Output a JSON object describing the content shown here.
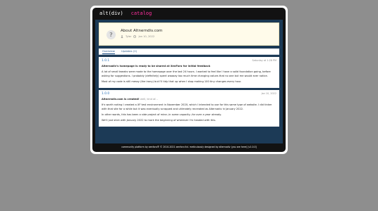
{
  "topbar": {
    "logo": "alt(div)",
    "nav_catalog": "catalog"
  },
  "header": {
    "avatar_glyph": "?",
    "title": "About Altnerndiv.com",
    "author": "Tyler",
    "date": "Jan 10, 2022",
    "author_icon": "user-icon",
    "date_icon": "clock-icon"
  },
  "tabs": [
    {
      "label": "Overview"
    },
    {
      "label": "Updates (2)"
    }
  ],
  "posts": [
    {
      "version": "1.0.1",
      "date": "Saturday at 1:28 PM",
      "headline": "Alternadiv's homepage is ready to be shared at XenForo for initial feedback",
      "headline_small": "",
      "paragraphs": [
        "A lot of small tweaks were made to the homepage over the last 24 hours. I wanted to feel like I have a solid foundation going, before asking for suggestions. I probably (definitely) spent waaaay too much time changing values that no one but me would ever notice.",
        "Most of my code is still messy (the irony) but I'll tidy that up when I stop making 100 tiny changes every hour."
      ]
    },
    {
      "version": "1.0.0",
      "date": "Jan 10, 2022",
      "headline": "Altnerndiv.com is created!",
      "headline_small": "well, kind of...",
      "paragraphs": [
        "It's worth noting I created a XF test environment in November 2020, which I intended to use for this same type of website. I did tinker with that site for a while but it was eventually scrapped and ultimately recreated as Alternadiv in January 2022.",
        "In other words, this has been a side project of mine--in some capacity--for over a year already.",
        "We'll just stick with January 2022 to mark the beginning of wherever I'm headed with this."
      ]
    }
  ],
  "footer": {
    "text": "community platform by xenforo® © 2010-2021 xenforo ltd. meticulously designed by alternadiv (you are here) [v1.0.0]"
  },
  "colors": {
    "page_bg": "#8e8e8e",
    "frame": "#ffffff",
    "topbar_bg": "#121212",
    "content_bg": "#1c3a56",
    "accent_pink": "#ff2f9e",
    "link_blue": "#2a72b8",
    "header_card_bg": "#fffbea"
  }
}
